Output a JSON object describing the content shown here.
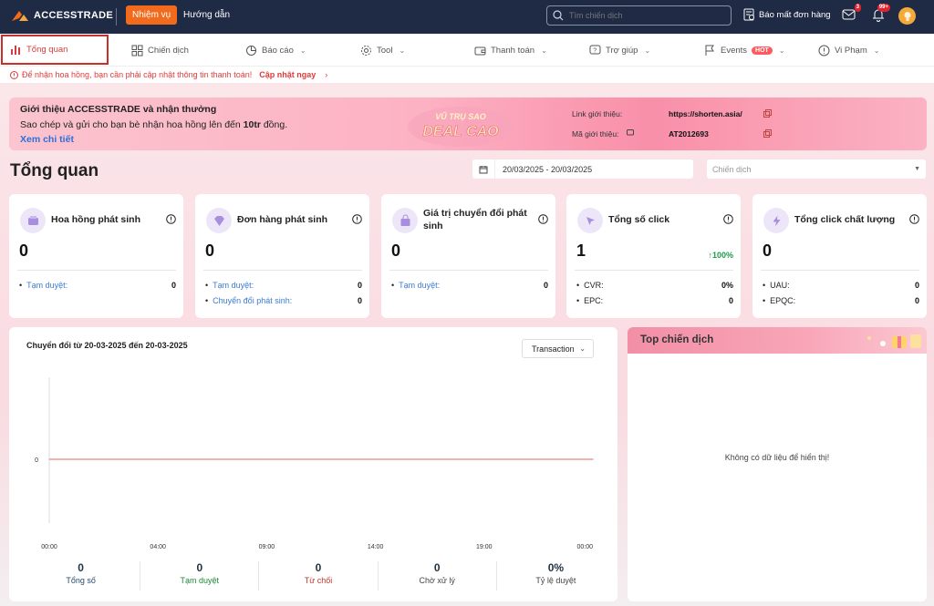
{
  "topbar": {
    "brand": "ACCESSTRADE",
    "mission_button": "Nhiệm vụ",
    "guide_link": "Hướng dẫn",
    "search_placeholder": "Tìm chiến dịch",
    "report_security": "Báo mất đơn hàng",
    "mail_badge": "3",
    "bell_badge": "99+"
  },
  "nav": {
    "items": [
      {
        "label": "Tổng quan"
      },
      {
        "label": "Chiến dịch"
      },
      {
        "label": "Báo cáo"
      },
      {
        "label": "Tool"
      },
      {
        "label": "Thanh toán"
      },
      {
        "label": "Trợ giúp"
      },
      {
        "label": "Events"
      },
      {
        "label": "Vi Phạm"
      }
    ],
    "hot_badge": "HOT"
  },
  "notice": {
    "text": "Để nhận hoa hồng, bạn cần phải cập nhật thông tin thanh toán!",
    "link": "Cập nhật ngay"
  },
  "banner": {
    "title": "Giới thiệu ACCESSTRADE và nhận thưởng",
    "desc_prefix": "Sao chép và gửi cho bạn bè nhận hoa hồng lên đến ",
    "desc_amount": "10tr",
    "desc_suffix": " đồng.",
    "link": "Xem chi tiết",
    "promo_line1": "VŨ TRỤ SAO",
    "promo_line2": "DEAL CAO",
    "ref_link_label": "Link giới thiệu:",
    "ref_link_value": "https://shorten.asia/",
    "ref_code_label": "Mã giới thiệu:",
    "ref_code_value": "AT2012693"
  },
  "page": {
    "title": "Tổng quan",
    "date_range": "20/03/2025 - 20/03/2025",
    "campaign_placeholder": "Chiến dịch"
  },
  "cards": [
    {
      "title": "Hoa hồng phát sinh",
      "value": "0",
      "rows": [
        {
          "k": "Tạm duyệt:",
          "v": "0"
        }
      ]
    },
    {
      "title": "Đơn hàng phát sinh",
      "value": "0",
      "rows": [
        {
          "k": "Tạm duyệt:",
          "v": "0"
        },
        {
          "k": "Chuyển đổi phát sinh:",
          "v": "0"
        }
      ]
    },
    {
      "title": "Giá trị chuyển đổi phát sinh",
      "value": "0",
      "rows": [
        {
          "k": "Tạm duyệt:",
          "v": "0"
        }
      ]
    },
    {
      "title": "Tổng số click",
      "value": "1",
      "pct": "100%",
      "rows": [
        {
          "k": "CVR:",
          "v": "0%"
        },
        {
          "k": "EPC:",
          "v": "0"
        }
      ]
    },
    {
      "title": "Tổng click chất lượng",
      "value": "0",
      "rows": [
        {
          "k": "UAU:",
          "v": "0"
        },
        {
          "k": "EPQC:",
          "v": "0"
        }
      ]
    }
  ],
  "conversion": {
    "title": "Chuyển đổi từ 20-03-2025 đến 20-03-2025",
    "select": "Transaction",
    "stats": [
      {
        "value": "0",
        "label": "Tổng số",
        "color": "#234a6b"
      },
      {
        "value": "0",
        "label": "Tạm duyệt",
        "color": "#1f8a3a"
      },
      {
        "value": "0",
        "label": "Từ chối",
        "color": "#c0392b"
      },
      {
        "value": "0",
        "label": "Chờ xử lý",
        "color": "#444444"
      },
      {
        "value": "0%",
        "label": "Tỷ lệ duyệt",
        "color": "#444444"
      }
    ]
  },
  "chart_data": {
    "type": "line",
    "x": [
      "00:00",
      "04:00",
      "09:00",
      "14:00",
      "19:00",
      "00:00"
    ],
    "series": [
      {
        "values": [
          0,
          0,
          0,
          0,
          0,
          0
        ]
      }
    ],
    "y_ticks": [
      "0"
    ],
    "line_color": "#e8897f"
  },
  "top_campaigns": {
    "title": "Top chiến dịch",
    "empty": "Không có dữ liệu để hiển thị!"
  }
}
